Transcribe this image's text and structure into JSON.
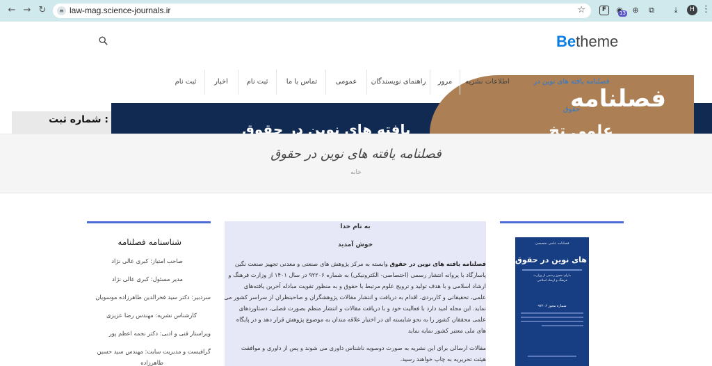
{
  "browser": {
    "url": "law-mag.science-journals.ir",
    "extension_badge": "13",
    "profile_initial": "H"
  },
  "header": {
    "logo_be": "Be",
    "logo_theme": "theme"
  },
  "menu": {
    "items": [
      "فصلنامه یافته های نوین در حقوق",
      "اطلاعات نشریه",
      "مرور",
      "راهنمای نویسندگان",
      "عمومی",
      "تماس با ما",
      "ثبت نام",
      "اخبار",
      "ثبت نام"
    ]
  },
  "banner": {
    "left_text": "شماره ثبت :",
    "navy_text": "یافته های نوین در حقوق",
    "brown_text": "فصلنامه",
    "brown_sub": "علمی تخ"
  },
  "title_band": {
    "title": "فصلنامه یافته های نوین در حقوق",
    "breadcrumb": "خانه"
  },
  "cover": {
    "top": "فصلنامه علمی تخصصی",
    "title": "یافته های نوین در حقوق",
    "sub1": "دارای مجوز رسمی از وزارت",
    "sub2": "فرهنگ و ارشاد اسلامی",
    "issue": "شماره مجوز ۹۲۲۰۶"
  },
  "intro": {
    "basmala": "به نام خدا",
    "welcome": "خوش آمدید",
    "lines": [
      [
        "فصلنامه یافته های نوین در حقوق",
        " وابسته به مرکز پژوهش های صنعتی و معدنی تجهیز صنعت نگین"
      ],
      [
        "",
        "پاسارگاد با پروانه انتشار رسمی (اختصاصی- الکترونیکی) به شماره ۹۲۲۰۶ در سال ۱۴۰۱ از وزارت فرهنگ و"
      ],
      [
        "",
        "ارشاد اسلامی و با هدف تولید و ترویج علوم مرتبط با حقوق  و به منظور تقویت مبادله آخرین یافته‌های"
      ],
      [
        "",
        "علمی، تحقیقاتی و کاربردی، اقدام به دریافت و انتشار مقالات پژوهشگران و صاحبنظران از سراسر کشور می‌"
      ],
      [
        "",
        "نماید. این مجله امید دارد با فعالیت خود و با دریافت مقالات و انتشار منظم بصورت فصلی، دستاوردهای"
      ],
      [
        "",
        "علمی  محققان کشور را به نحو شایسته ای در اختیار علاقه مندان به موضوع پژوهش قرار دهد و در پایگاه"
      ],
      [
        "",
        "های ملی معتبر کشور نمایه نماید"
      ]
    ],
    "lines2": [
      "مقالات ارسالی برای این نشریه به صورت دوسویه ناشناس داوری می شوند و پس از داوری و موافقت",
      "هیئت تحریریه به چاپ خواهند رسید."
    ]
  },
  "identity": {
    "title": "شناسنامه فصلنامه",
    "items": [
      "صاحب امتیاز: کبری عالی نژاد",
      "مدیر مسئول: کبری عالی نژاد",
      "سردبیر: دکتر سید فخرالدین طاهرزاده موسویان",
      "کارشناس نشریه: مهندس رضا عزیزی",
      "ویراستار فنی و ادبی: دکتر نجمه اعظم پور",
      "گرافیست و مدیریت سایت: مهندس سید حسین",
      "طاهرزاده"
    ]
  }
}
